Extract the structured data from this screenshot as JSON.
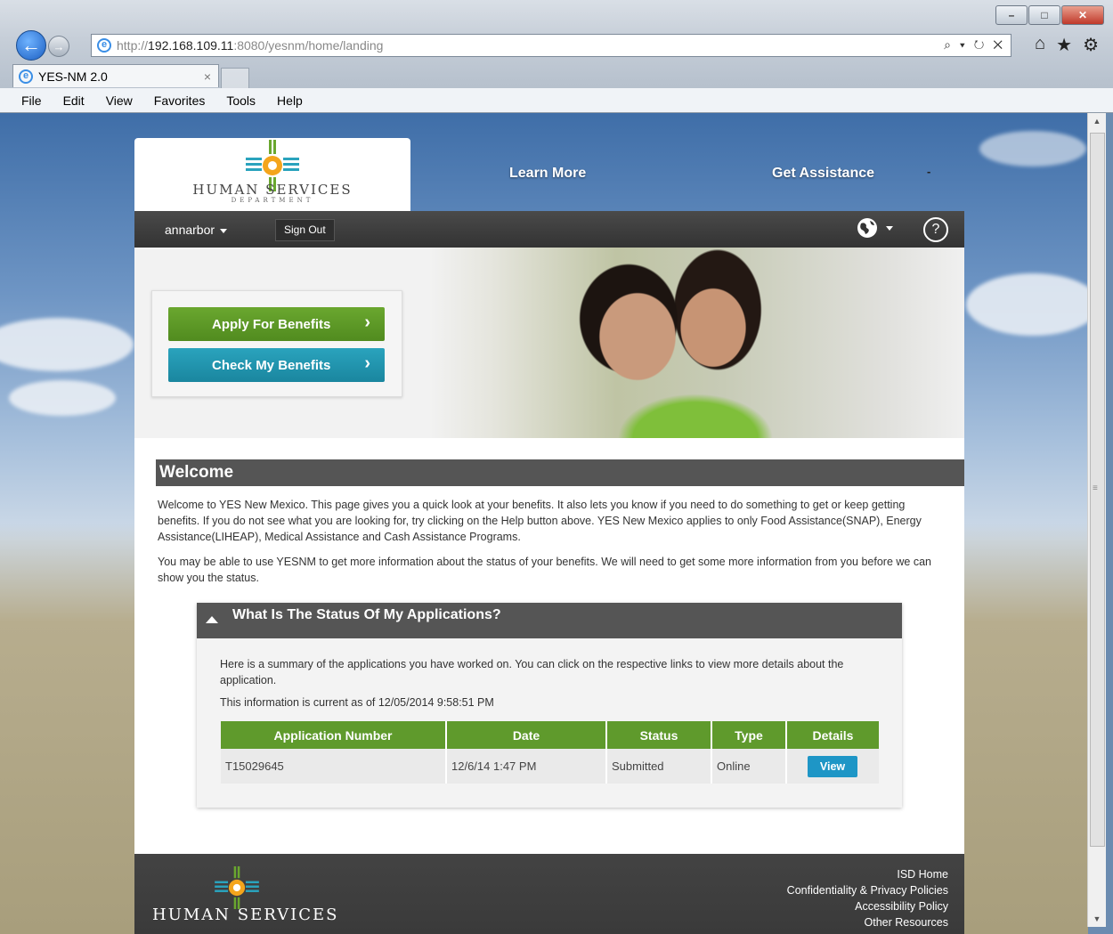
{
  "browser": {
    "url_prefix": "http://",
    "url_host": "192.168.109.11",
    "url_rest": ":8080/yesnm/home/landing",
    "addr_icons": "⌕ ▾ ↻ ✕",
    "tab_title": "YES-NM 2.0",
    "tab_close": "×",
    "menu": [
      "File",
      "Edit",
      "View",
      "Favorites",
      "Tools",
      "Help"
    ]
  },
  "header": {
    "logo_text": "HUMAN SERVICES",
    "logo_sub": "DEPARTMENT",
    "learn_more": "Learn More",
    "get_assistance": "Get Assistance",
    "dash": "-",
    "username": "annarbor",
    "sign_out": "Sign Out",
    "help": "?"
  },
  "hero": {
    "apply_label": "Apply For Benefits",
    "check_label": "Check My Benefits"
  },
  "welcome": {
    "title": "Welcome",
    "para1": "Welcome to YES New Mexico. This page gives you a quick look at your benefits. It also lets you know if you need to do something to get or keep getting benefits. If you do not see what you are looking for, try clicking on the Help button above. YES New Mexico applies to only Food Assistance(SNAP), Energy Assistance(LIHEAP), Medical Assistance and Cash Assistance Programs.",
    "para2": "You may be able to use YESNM to get more information about the status of your benefits. We will need to get some more information from you before we can show you the status."
  },
  "status": {
    "title": "What Is The Status Of My Applications?",
    "description": "Here is a summary of the applications you have worked on. You can click on the respective links to view more details about the application.",
    "current_as_of": "This information is current as of 12/05/2014 9:58:51 PM",
    "columns": [
      "Application Number",
      "Date",
      "Status",
      "Type",
      "Details"
    ],
    "rows": [
      {
        "number": "T15029645",
        "date": "12/6/14 1:47 PM",
        "status": "Submitted",
        "type": "Online",
        "details": "View"
      }
    ]
  },
  "footer": {
    "logo_text": "HUMAN SERVICES",
    "links": [
      "ISD Home",
      "Confidentiality & Privacy Policies",
      "Accessibility Policy",
      "Other Resources"
    ]
  },
  "colors": {
    "apply_green": "#5f9a2c",
    "check_teal": "#1e96c6",
    "dark_bar": "#555555"
  }
}
